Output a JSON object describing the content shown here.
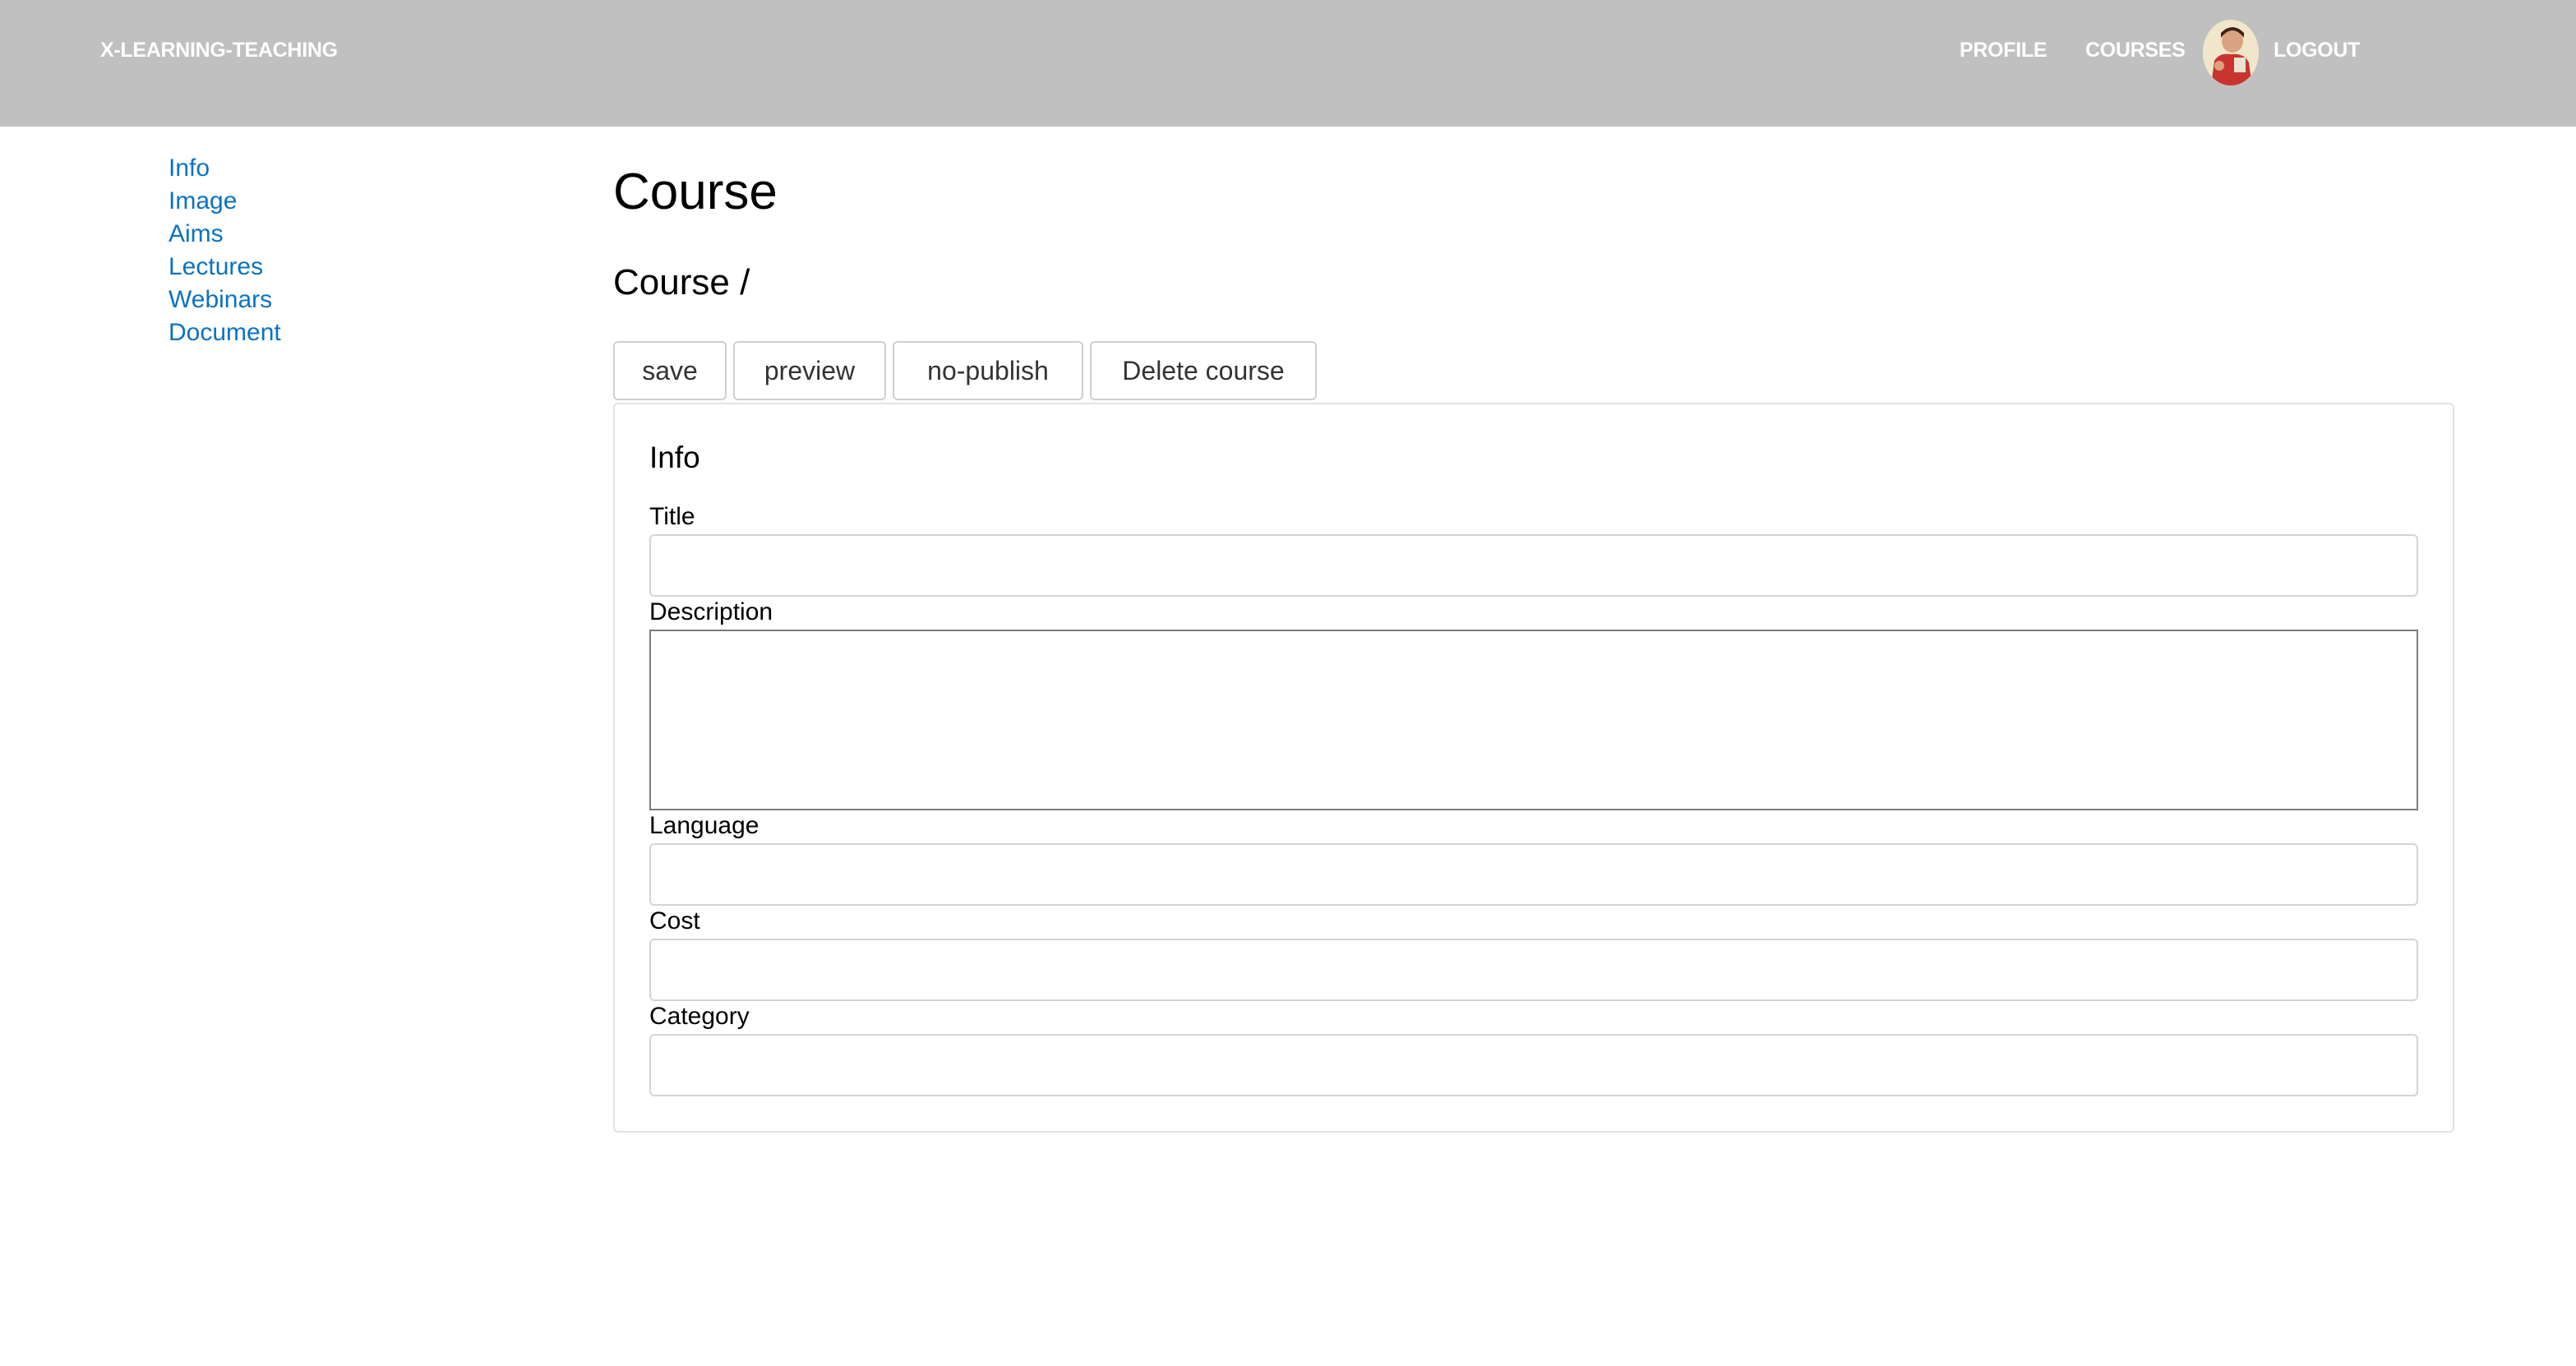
{
  "header": {
    "brand": "X-LEARNING-TEACHING",
    "nav": {
      "profile": "PROFILE",
      "courses": "COURSES",
      "logout": "LOGOUT"
    },
    "avatar_icon": "user-avatar-icon",
    "background_color": "#c0c0c0"
  },
  "sidebar": {
    "items": [
      {
        "label": "Info"
      },
      {
        "label": "Image"
      },
      {
        "label": "Aims"
      },
      {
        "label": "Lectures"
      },
      {
        "label": "Webinars"
      },
      {
        "label": "Document"
      }
    ],
    "link_color": "#0b72c2"
  },
  "main": {
    "title": "Course",
    "subtitle": "Course /",
    "toolbar": {
      "save_label": "save",
      "preview_label": "preview",
      "no_publish_label": "no-publish",
      "delete_label": "Delete course"
    },
    "panel": {
      "title": "Info",
      "fields": {
        "title": {
          "label": "Title",
          "value": ""
        },
        "description": {
          "label": "Description",
          "value": ""
        },
        "language": {
          "label": "Language",
          "value": ""
        },
        "cost": {
          "label": "Cost",
          "value": ""
        },
        "category": {
          "label": "Category",
          "value": ""
        }
      }
    }
  }
}
